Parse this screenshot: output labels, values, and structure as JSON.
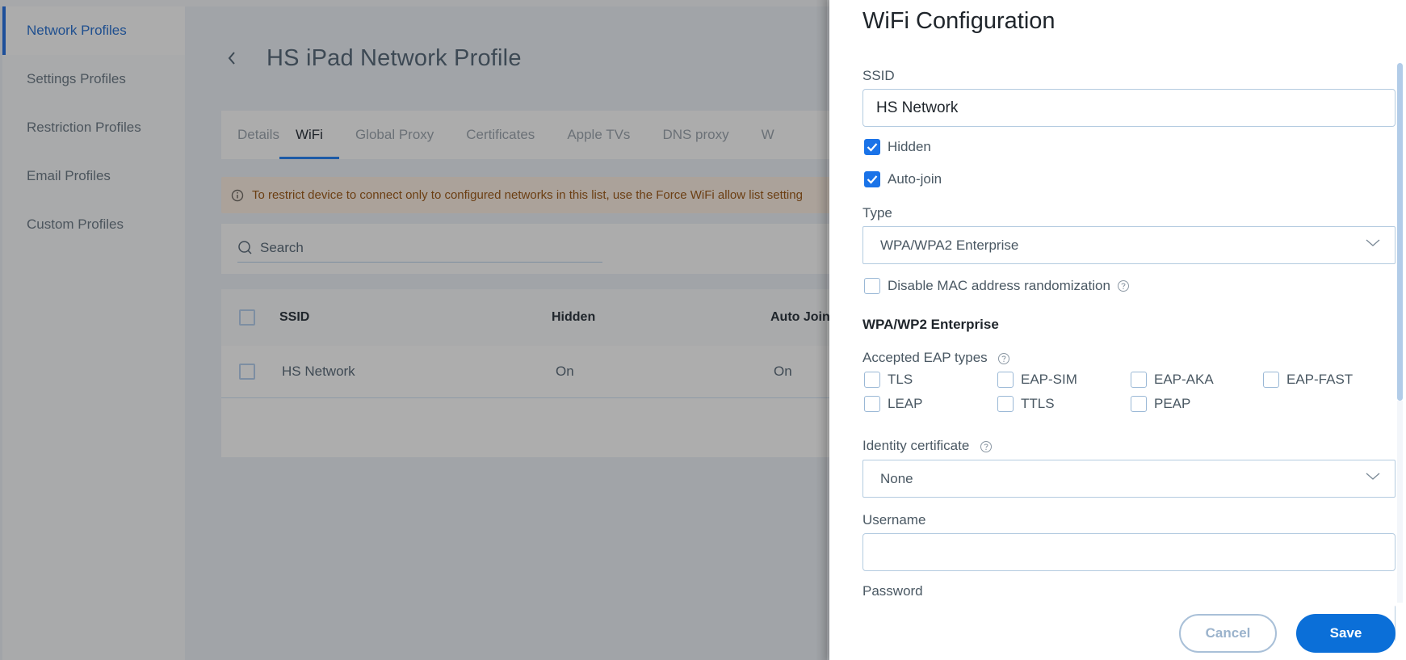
{
  "sidebar": {
    "items": [
      {
        "label": "Network Profiles",
        "active": true
      },
      {
        "label": "Settings Profiles",
        "active": false
      },
      {
        "label": "Restriction Profiles",
        "active": false
      },
      {
        "label": "Email Profiles",
        "active": false
      },
      {
        "label": "Custom Profiles",
        "active": false
      }
    ]
  },
  "header": {
    "back_icon": "chevron-left-icon",
    "title": "HS iPad Network Profile"
  },
  "tabs": [
    {
      "label": "Details",
      "active": false
    },
    {
      "label": "WiFi",
      "active": true
    },
    {
      "label": "Global Proxy",
      "active": false
    },
    {
      "label": "Certificates",
      "active": false
    },
    {
      "label": "Apple TVs",
      "active": false
    },
    {
      "label": "DNS proxy",
      "active": false
    },
    {
      "label": "W",
      "active": false
    }
  ],
  "alert": {
    "icon": "info-icon",
    "text": "To restrict device to connect only to configured networks in this list, use the Force WiFi allow list setting"
  },
  "search": {
    "placeholder": "Search",
    "value": ""
  },
  "table": {
    "columns": [
      "SSID",
      "Hidden",
      "Auto Join"
    ],
    "rows": [
      {
        "ssid": "HS Network",
        "hidden": "On",
        "auto_join": "On",
        "selected": false
      }
    ]
  },
  "panel": {
    "title": "WiFi Configuration",
    "close_icon": "close-icon",
    "ssid": {
      "label": "SSID",
      "value": "HS Network"
    },
    "hidden": {
      "label": "Hidden",
      "checked": true
    },
    "auto_join": {
      "label": "Auto-join",
      "checked": true
    },
    "type": {
      "label": "Type",
      "value": "WPA/WPA2 Enterprise"
    },
    "disable_mac": {
      "label": "Disable MAC address randomization",
      "checked": false
    },
    "section_title": "WPA/WP2 Enterprise",
    "eap": {
      "label": "Accepted EAP types",
      "types": [
        {
          "label": "TLS",
          "checked": false
        },
        {
          "label": "EAP-SIM",
          "checked": false
        },
        {
          "label": "EAP-AKA",
          "checked": false
        },
        {
          "label": "EAP-FAST",
          "checked": false
        },
        {
          "label": "LEAP",
          "checked": false
        },
        {
          "label": "TTLS",
          "checked": false
        },
        {
          "label": "PEAP",
          "checked": false
        }
      ]
    },
    "identity_certificate": {
      "label": "Identity certificate",
      "value": "None"
    },
    "username": {
      "label": "Username",
      "value": ""
    },
    "password": {
      "label": "Password",
      "value": ""
    },
    "buttons": {
      "cancel": "Cancel",
      "save": "Save"
    }
  },
  "colors": {
    "accent": "#0b6fd8",
    "checkbox_checked": "#1a73e8",
    "sidebar_active": "#1d4f9a",
    "alert_text": "#6b3e12"
  }
}
